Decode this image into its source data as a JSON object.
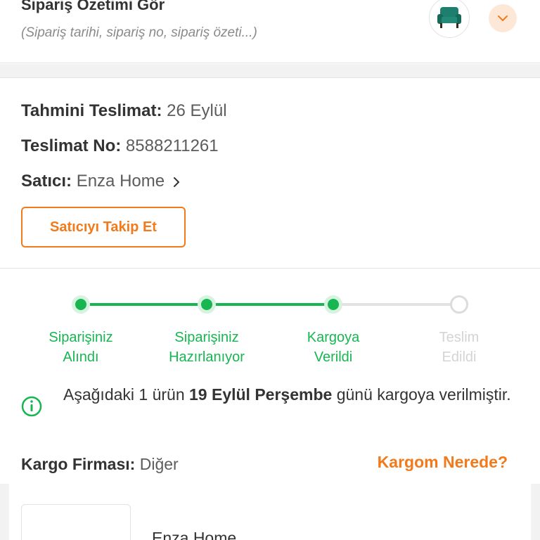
{
  "summary": {
    "title": "Sipariş Özetimi Gör",
    "subtitle": "(Sipariş tarihi, sipariş no, sipariş özeti...)",
    "thumbnail_icon": "armchair-icon",
    "toggle_icon": "chevron-down-icon"
  },
  "delivery": {
    "estimated_label": "Tahmini Teslimat:",
    "estimated_value": "26 Eylül",
    "number_label": "Teslimat No:",
    "number_value": "8588211261",
    "seller_label": "Satıcı:",
    "seller_value": "Enza Home",
    "follow_button": "Satıcıyı Takip Et"
  },
  "tracking": {
    "steps": [
      {
        "line1": "Siparişiniz",
        "line2": "Alındı",
        "done": true
      },
      {
        "line1": "Siparişiniz",
        "line2": "Hazırlanıyor",
        "done": true
      },
      {
        "line1": "Kargoya",
        "line2": "Verildi",
        "done": true
      },
      {
        "line1": "Teslim",
        "line2": "Edildi",
        "done": false
      }
    ]
  },
  "notice": {
    "icon": "info-icon",
    "part1": "Aşağıdaki 1 ürün ",
    "bold": "19 Eylül Perşembe",
    "part2": " günü kargoya verilmiştir."
  },
  "cargo": {
    "label": "Kargo Firması:",
    "value": "Diğer",
    "link": "Kargom Nerede?"
  },
  "product": {
    "seller": "Enza Home"
  },
  "colors": {
    "accent": "#f27a1a",
    "success": "#17b651",
    "inactive": "#dcdcdc"
  }
}
